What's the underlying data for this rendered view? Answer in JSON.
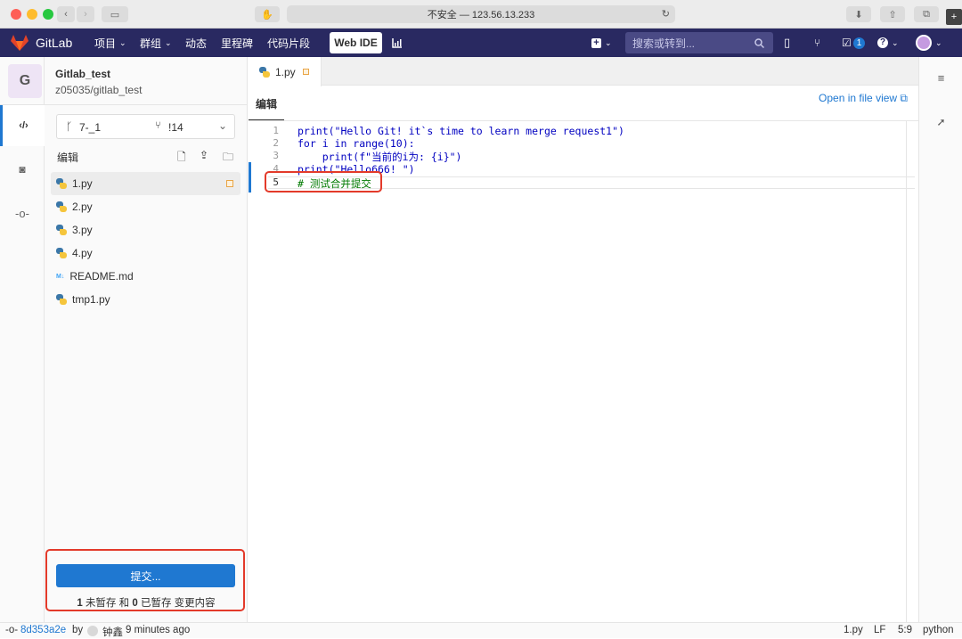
{
  "browser": {
    "url": "不安全 — 123.56.13.233"
  },
  "navbar": {
    "brand": "GitLab",
    "items": [
      "项目",
      "群组",
      "动态",
      "里程碑",
      "代码片段"
    ],
    "web_ide": "Web IDE",
    "search_placeholder": "搜索或转到...",
    "todo_count": "1"
  },
  "project": {
    "avatar_letter": "G",
    "name": "Gitlab_test",
    "path": "z05035/gitlab_test"
  },
  "sidebar": {
    "branch": "7-_1",
    "merge_request": "!14",
    "section_title": "编辑",
    "files": [
      "1.py",
      "2.py",
      "3.py",
      "4.py",
      "README.md",
      "tmp1.py"
    ],
    "commit_button": "提交...",
    "changes": {
      "unstaged_count": "1",
      "unstaged_label": "未暂存 和",
      "staged_count": "0",
      "staged_label": "已暂存 变更内容"
    }
  },
  "editor": {
    "tab_label": "1.py",
    "mode_label": "编辑",
    "open_file_view": "Open in file view",
    "lines": [
      {
        "num": "1",
        "text": "print(\"Hello Git! it`s time to learn merge request1\")"
      },
      {
        "num": "2",
        "text": "for i in range(10):"
      },
      {
        "num": "3",
        "text": "    print(f\"当前的i为: {i}\")"
      },
      {
        "num": "4",
        "text": "print(\"Hello666! \")"
      },
      {
        "num": "5",
        "text": "# 测试合并提交"
      }
    ]
  },
  "status": {
    "commit_sha": "8d353a2e",
    "by": "by",
    "author": "钟鑫",
    "time": "9 minutes ago",
    "file": "1.py",
    "eol": "LF",
    "position": "5:9",
    "language": "python"
  },
  "colors": {
    "navbar": "#292961",
    "commit_button": "#1f78d1",
    "highlight_box": "#e33a2a"
  }
}
